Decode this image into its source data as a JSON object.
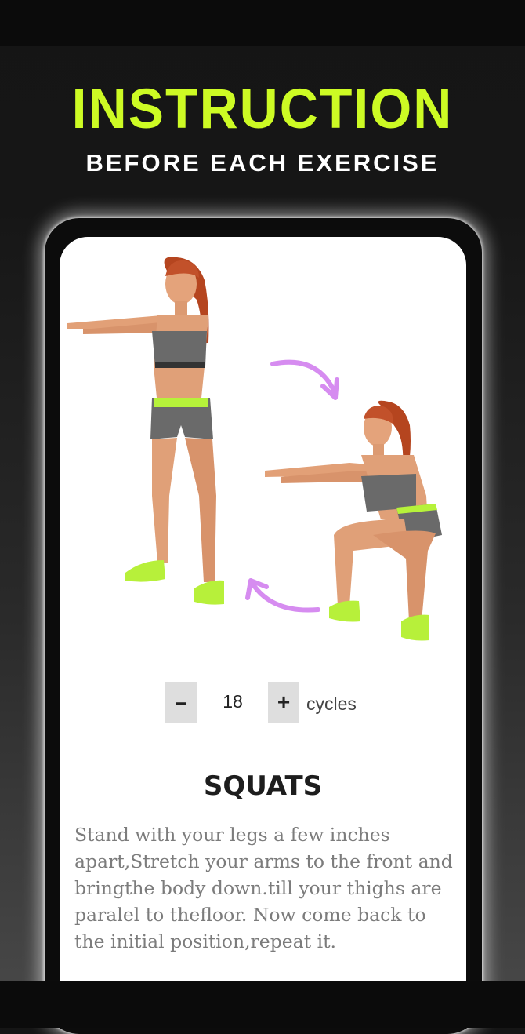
{
  "header": {
    "title": "INSTRUCTION",
    "subtitle": "BEFORE EACH EXERCISE"
  },
  "colors": {
    "accent": "#cdfb24",
    "arrow": "#d68cf0"
  },
  "icons": {
    "arrow_top": "curved-arrow-down-icon",
    "arrow_bottom": "curved-arrow-up-icon"
  },
  "counter": {
    "minus_label": "–",
    "value": "18",
    "plus_label": "+",
    "unit": "cycles"
  },
  "exercise": {
    "name": "SQUATS",
    "description": "Stand with your legs a few inches apart,Stretch your arms to the front and bringthe body down.till your thighs are paralel to thefloor. Now come back to the initial position,repeat it."
  }
}
